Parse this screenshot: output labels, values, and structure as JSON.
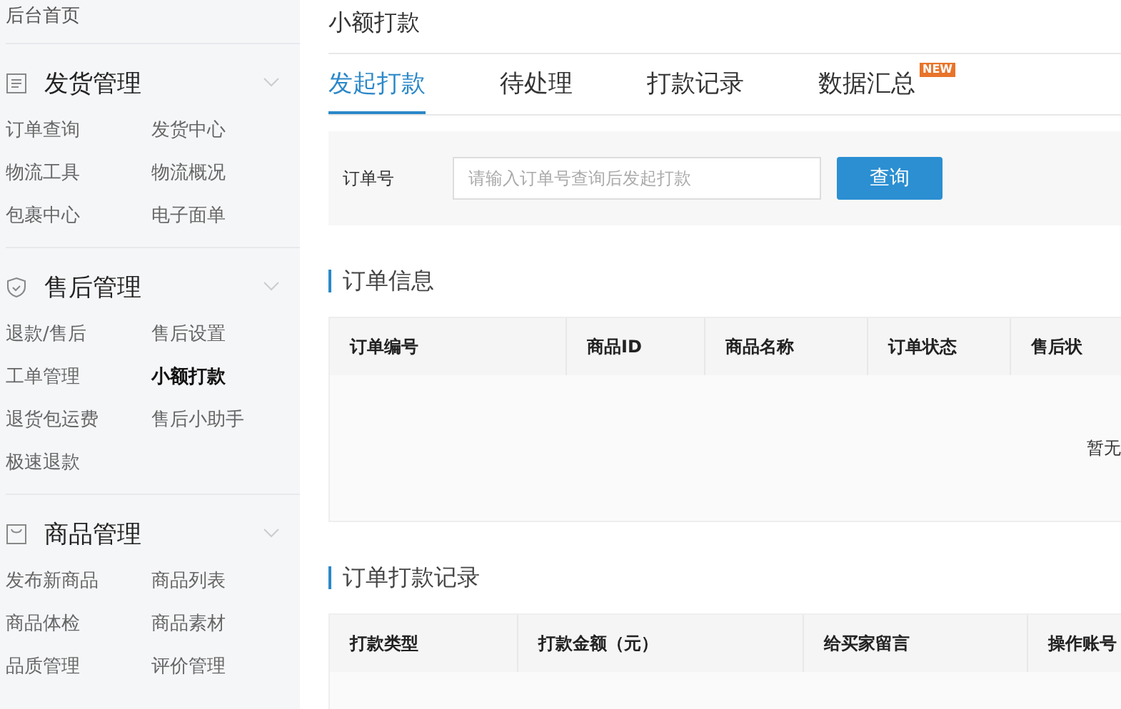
{
  "sidebar": {
    "home": "后台首页",
    "groups": [
      {
        "kind": "list",
        "title": "发货管理",
        "expanded": true,
        "items": [
          {
            "label": "订单查询",
            "selected": false
          },
          {
            "label": "发货中心",
            "selected": false
          },
          {
            "label": "物流工具",
            "selected": false
          },
          {
            "label": "物流概况",
            "selected": false
          },
          {
            "label": "包裹中心",
            "selected": false
          },
          {
            "label": "电子面单",
            "selected": false
          }
        ]
      },
      {
        "kind": "shield",
        "title": "售后管理",
        "expanded": true,
        "items": [
          {
            "label": "退款/售后",
            "selected": false
          },
          {
            "label": "售后设置",
            "selected": false
          },
          {
            "label": "工单管理",
            "selected": false
          },
          {
            "label": "小额打款",
            "selected": true
          },
          {
            "label": "退货包运费",
            "selected": false
          },
          {
            "label": "售后小助手",
            "selected": false
          },
          {
            "label": "极速退款",
            "selected": false
          }
        ]
      },
      {
        "kind": "bag",
        "title": "商品管理",
        "expanded": true,
        "items": [
          {
            "label": "发布新商品",
            "selected": false
          },
          {
            "label": "商品列表",
            "selected": false
          },
          {
            "label": "商品体检",
            "selected": false
          },
          {
            "label": "商品素材",
            "selected": false
          },
          {
            "label": "品质管理",
            "selected": false
          },
          {
            "label": "评价管理",
            "selected": false
          }
        ]
      }
    ]
  },
  "page_title": "小额打款",
  "tabs": [
    {
      "label": "发起打款",
      "selected": true
    },
    {
      "label": "待处理",
      "selected": false
    },
    {
      "label": "打款记录",
      "selected": false
    },
    {
      "label": "数据汇总",
      "selected": false,
      "badge": "NEW"
    }
  ],
  "search": {
    "label": "订单号",
    "placeholder": "请输入订单号查询后发起打款",
    "button": "查询"
  },
  "order_info": {
    "title": "订单信息",
    "columns": [
      "订单编号",
      "商品ID",
      "商品名称",
      "订单状态",
      "售后状"
    ],
    "empty": "暂无"
  },
  "payment_records": {
    "title": "订单打款记录",
    "columns": [
      "打款类型",
      "打款金额（元）",
      "给买家留言",
      "操作账号"
    ]
  }
}
